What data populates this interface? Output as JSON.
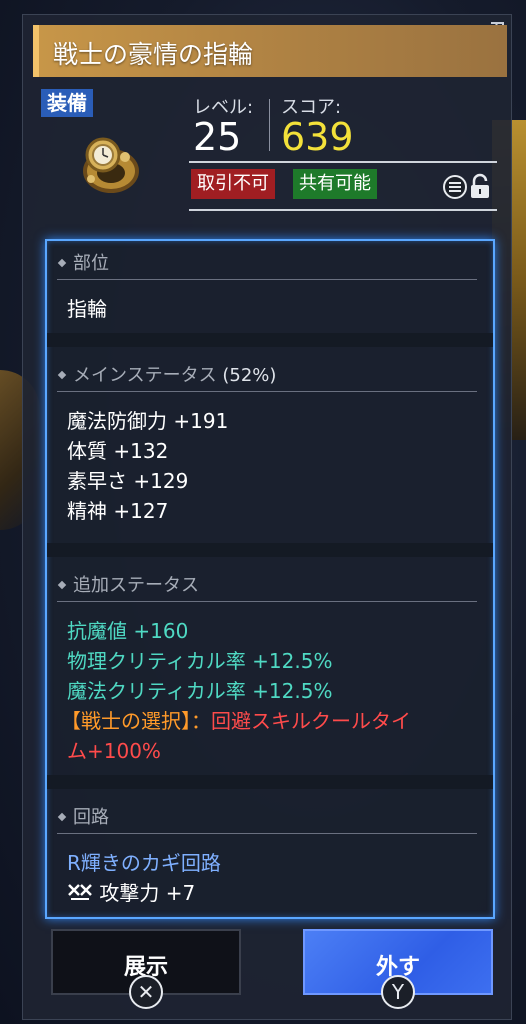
{
  "item": {
    "name": "戦士の豪情の指輪",
    "category": "装備",
    "icon": "ring-icon"
  },
  "stats": {
    "level_label": "レベル:",
    "level_value": "25",
    "score_label": "スコア:",
    "score_value": "639",
    "tag_untradeable": "取引不可",
    "tag_shareable": "共有可能"
  },
  "sections": {
    "slot": {
      "heading": "部位",
      "value": "指輪"
    },
    "main": {
      "heading": "メインステータス",
      "percent": "(52%)",
      "lines": [
        "魔法防御力 +191",
        "体質 +132",
        "素早さ +129",
        "精神 +127"
      ]
    },
    "extra": {
      "heading": "追加ステータス",
      "lines": [
        "抗魔値 +160",
        "物理クリティカル率 +12.5%",
        "魔法クリティカル率 +12.5%"
      ],
      "special_label": "【戦士の選択】：",
      "special_text_1": "回避スキルクールタイ",
      "special_text_2": "ム+100%"
    },
    "circuit": {
      "heading": "回路",
      "name": "R輝きのカギ回路",
      "bonus": "攻撃力 +7"
    }
  },
  "buttons": {
    "show_label": "展示",
    "show_glyph": "✕",
    "remove_label": "外す",
    "remove_glyph": "Y"
  },
  "colors": {
    "accent_gold": "#c79648",
    "score_yellow": "#f3e13a",
    "teal_stat": "#4fd9c3",
    "special_red": "#ff4b4b",
    "special_orange": "#ff9a2a",
    "frame_blue": "#5aa7ff"
  }
}
